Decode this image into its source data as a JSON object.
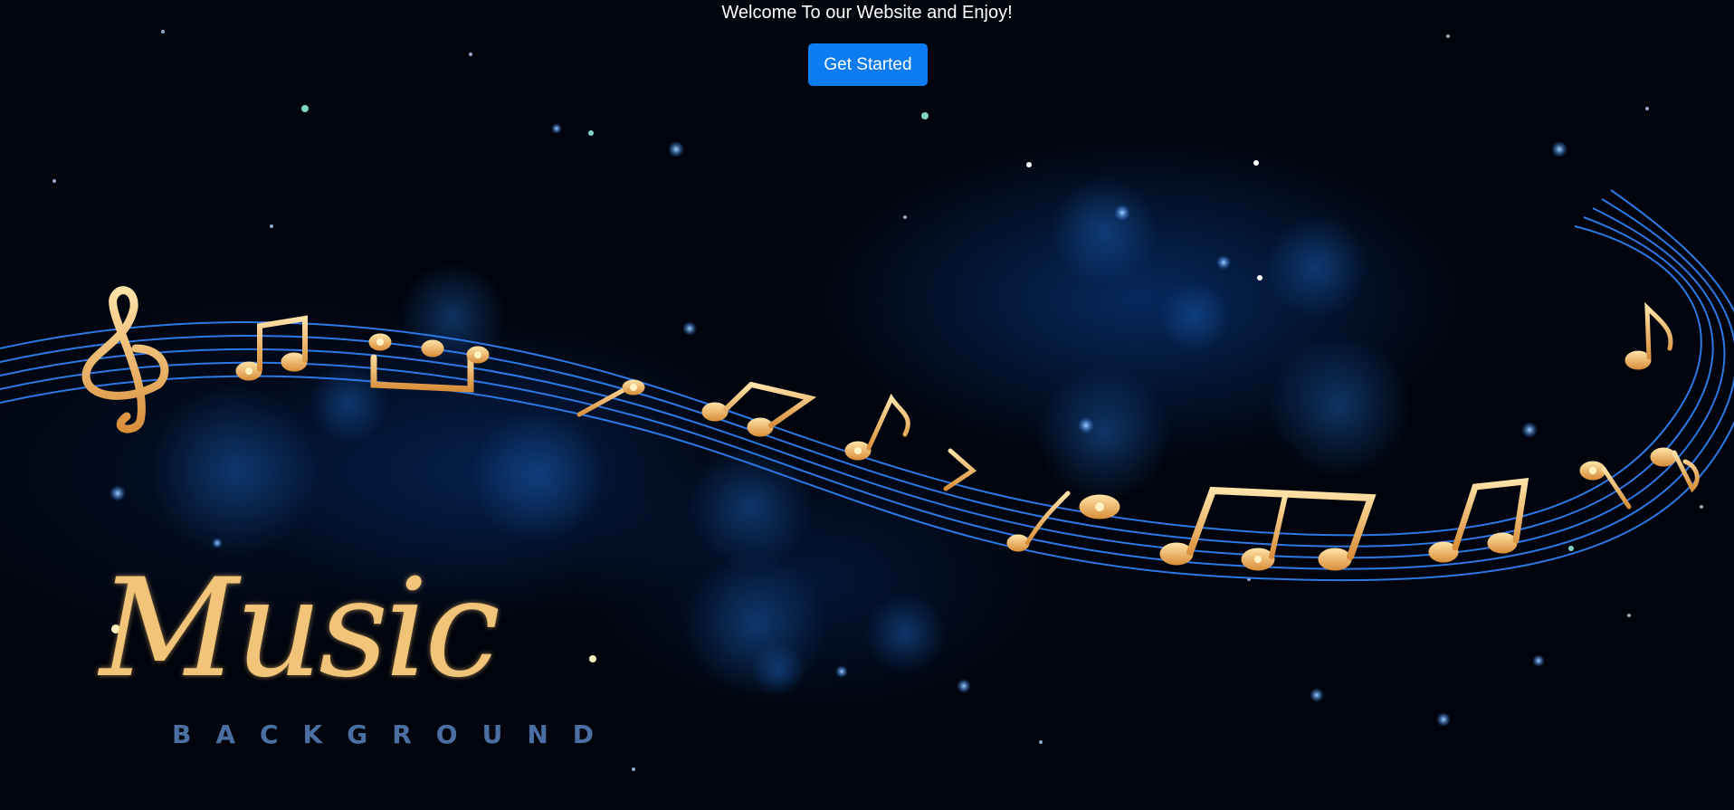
{
  "page": {
    "welcome_text": "Welcome To our Website and Enjoy!",
    "cta_label": "Get Started"
  },
  "background": {
    "logo_title": "Music",
    "logo_subtitle": "BACKGROUND",
    "theme_colors": {
      "sky": "#01040c",
      "staff_lines": "#2f7ff0",
      "notes_gold": "#f2b866",
      "button": "#0d7cf2"
    }
  }
}
